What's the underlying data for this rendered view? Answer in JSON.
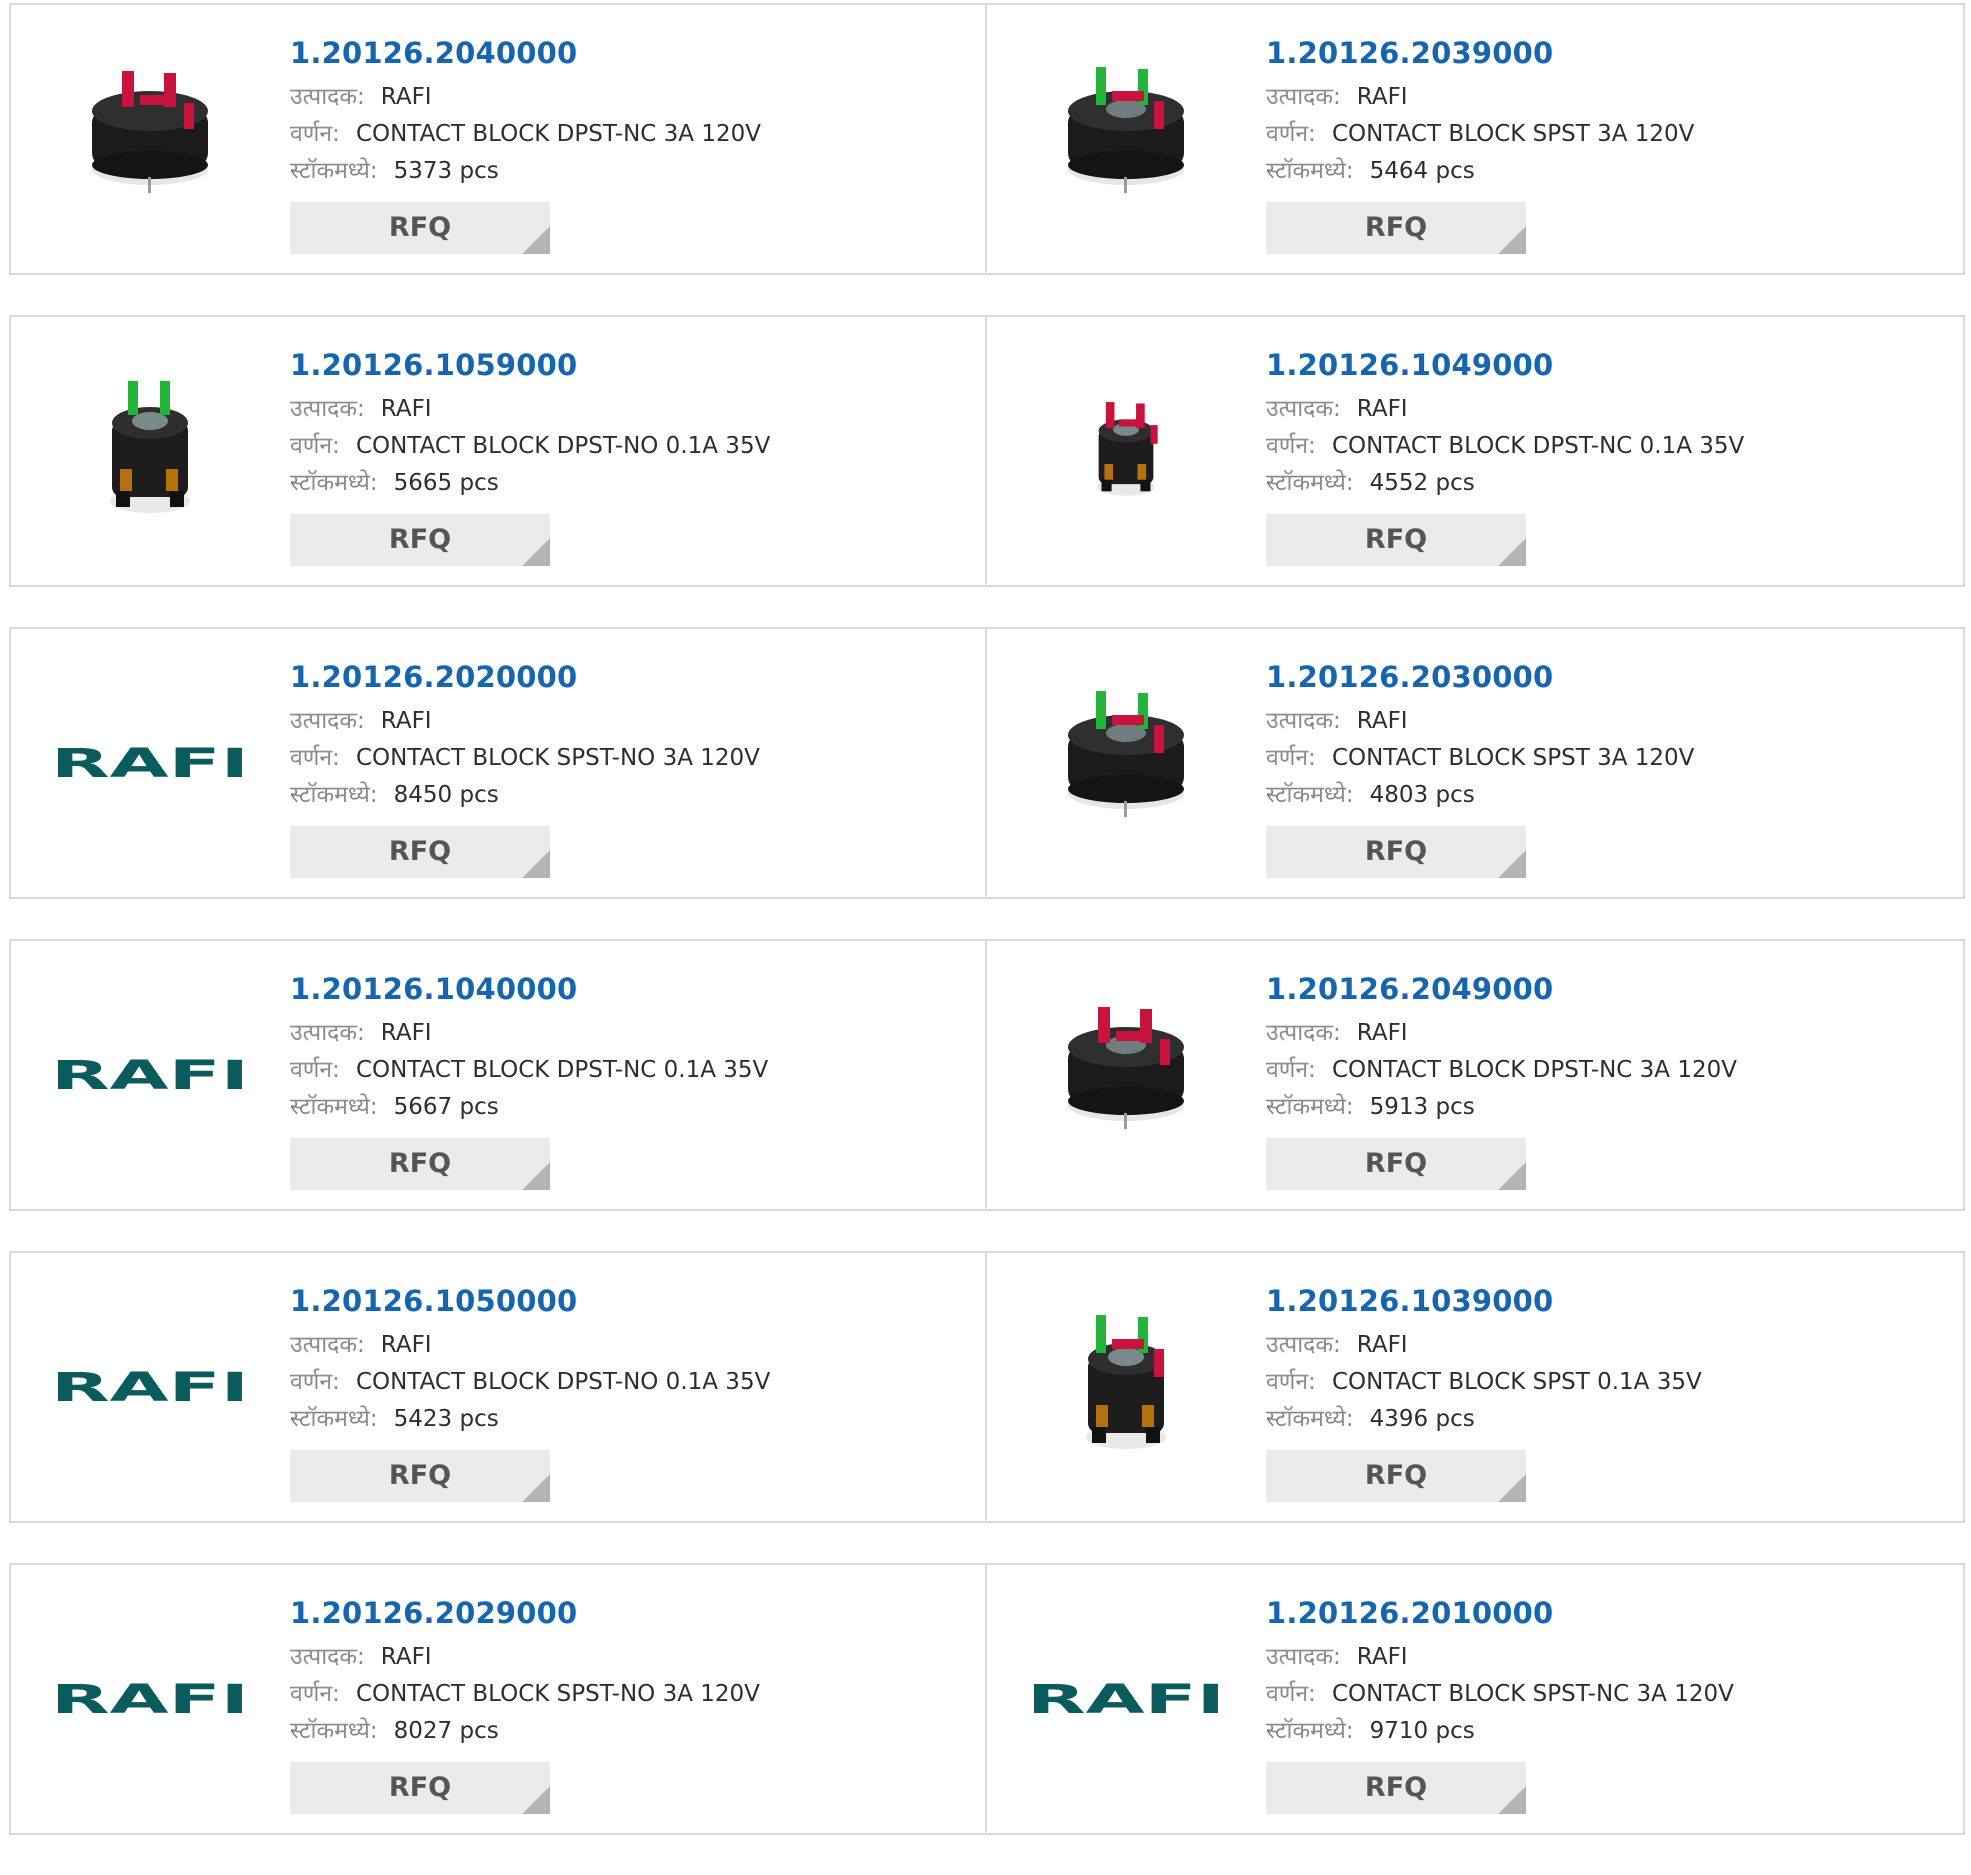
{
  "labels": {
    "manufacturer": "उत्पादक:",
    "description": "वर्णन:",
    "stock": "स्टॉकमध्ये:",
    "rfq": "RFQ"
  },
  "colors": {
    "part_number": "#1565b0",
    "logo": "#0a5c5c",
    "border": "#d9d9d9",
    "button_bg": "#ebebeb"
  },
  "products": [
    {
      "part_number": "1.20126.2040000",
      "manufacturer": "RAFI",
      "description": "CONTACT BLOCK DPST-NC 3A 120V",
      "stock": "5373 pcs",
      "image": "contact-block-red-pins"
    },
    {
      "part_number": "1.20126.2039000",
      "manufacturer": "RAFI",
      "description": "CONTACT BLOCK SPST 3A 120V",
      "stock": "5464 pcs",
      "image": "contact-block-red-green-pins"
    },
    {
      "part_number": "1.20126.1059000",
      "manufacturer": "RAFI",
      "description": "CONTACT BLOCK DPST-NO 0.1A 35V",
      "stock": "5665 pcs",
      "image": "contact-block-tall-green"
    },
    {
      "part_number": "1.20126.1049000",
      "manufacturer": "RAFI",
      "description": "CONTACT BLOCK DPST-NC 0.1A 35V",
      "stock": "4552 pcs",
      "image": "contact-block-tall-red-small"
    },
    {
      "part_number": "1.20126.2020000",
      "manufacturer": "RAFI",
      "description": "CONTACT BLOCK SPST-NO 3A 120V",
      "stock": "8450 pcs",
      "image": "rafi-logo",
      "logo_text": "RAFI"
    },
    {
      "part_number": "1.20126.2030000",
      "manufacturer": "RAFI",
      "description": "CONTACT BLOCK SPST 3A 120V",
      "stock": "4803 pcs",
      "image": "contact-block-red-green-pins"
    },
    {
      "part_number": "1.20126.1040000",
      "manufacturer": "RAFI",
      "description": "CONTACT BLOCK DPST-NC 0.1A 35V",
      "stock": "5667 pcs",
      "image": "rafi-logo",
      "logo_text": "RAFI"
    },
    {
      "part_number": "1.20126.2049000",
      "manufacturer": "RAFI",
      "description": "CONTACT BLOCK DPST-NC 3A 120V",
      "stock": "5913 pcs",
      "image": "contact-block-red-pins-ring"
    },
    {
      "part_number": "1.20126.1050000",
      "manufacturer": "RAFI",
      "description": "CONTACT BLOCK DPST-NO 0.1A 35V",
      "stock": "5423 pcs",
      "image": "rafi-logo",
      "logo_text": "RAFI"
    },
    {
      "part_number": "1.20126.1039000",
      "manufacturer": "RAFI",
      "description": "CONTACT BLOCK SPST 0.1A 35V",
      "stock": "4396 pcs",
      "image": "contact-block-tall-red-green"
    },
    {
      "part_number": "1.20126.2029000",
      "manufacturer": "RAFI",
      "description": "CONTACT BLOCK SPST-NO 3A 120V",
      "stock": "8027 pcs",
      "image": "rafi-logo",
      "logo_text": "RAFI"
    },
    {
      "part_number": "1.20126.2010000",
      "manufacturer": "RAFI",
      "description": "CONTACT BLOCK SPST-NC 3A 120V",
      "stock": "9710 pcs",
      "image": "rafi-logo",
      "logo_text": "RAFI"
    }
  ]
}
